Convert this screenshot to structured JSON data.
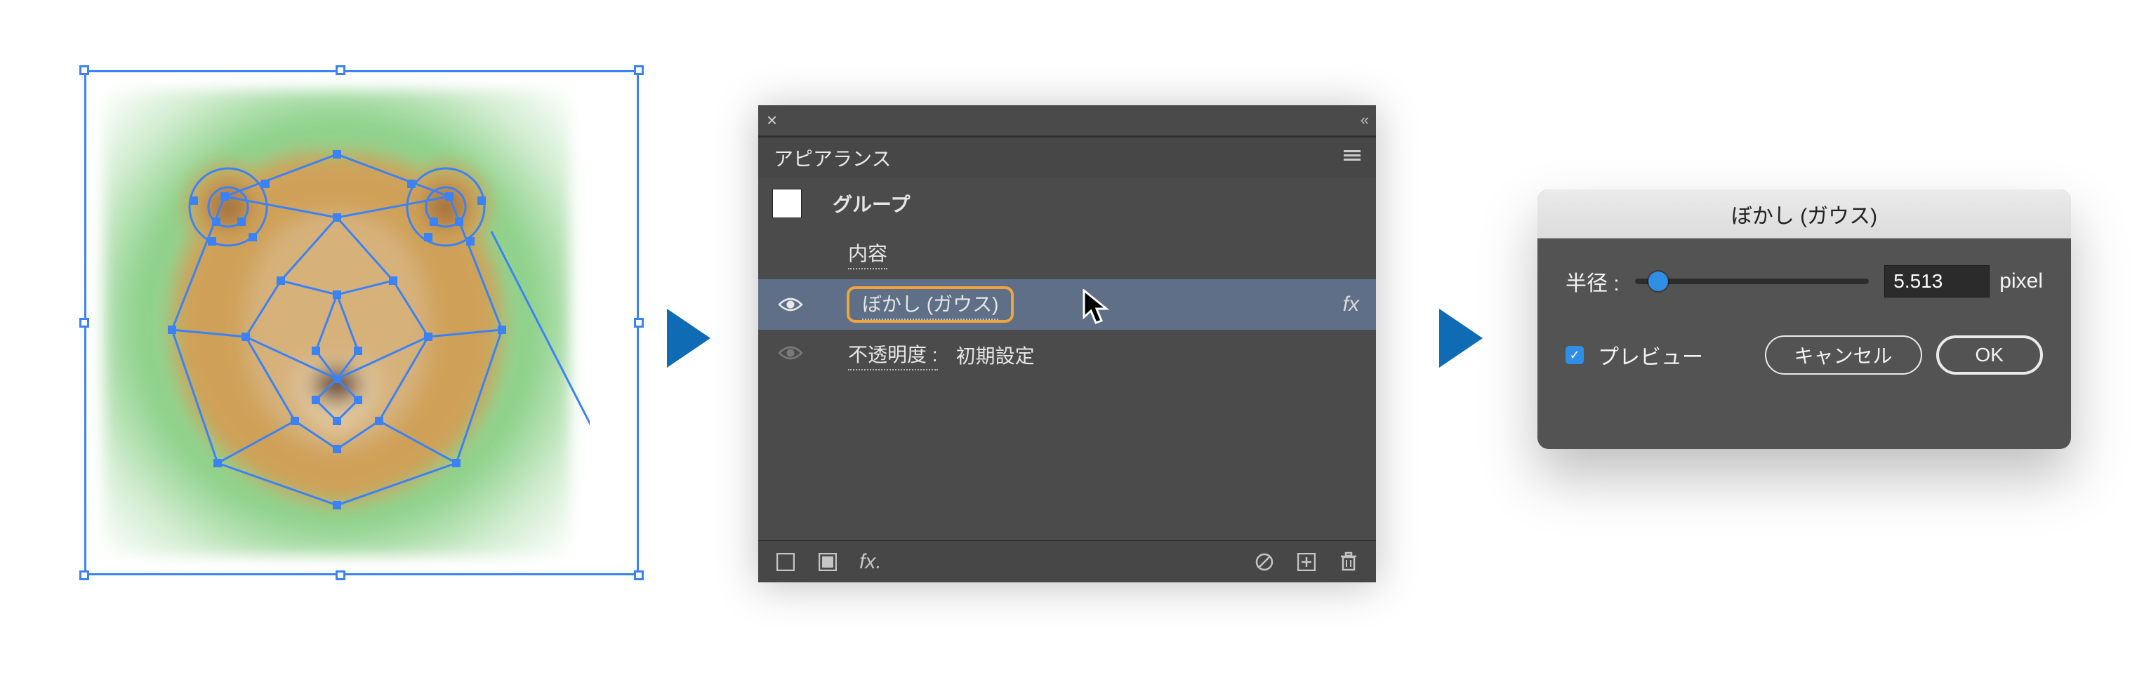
{
  "canvas": {
    "selection_color": "#3b82f6",
    "bg_green": "#8fd28c",
    "lion_palette": {
      "main": "#cfa158",
      "face": "#d6b17a",
      "muzzle_light": "#e0c79e",
      "nose": "#6a4a3c",
      "ear_inner": "#a77640"
    },
    "anchor_count": 58
  },
  "arrows": {
    "color": "#0f6bb3"
  },
  "panel": {
    "close_glyph": "×",
    "collapse_glyph": "«",
    "title": "アピアランス",
    "swatch_fill": "#ffffff",
    "group_label": "グループ",
    "contents_label": "内容",
    "blur_label": "ぼかし (ガウス)",
    "fx_glyph": "fx",
    "opacity_label": "不透明度 :",
    "opacity_value": "初期設定",
    "footer": {
      "icon_names": [
        "no-fill-icon",
        "swatch-icon",
        "fx-menu-icon",
        "prohibit-icon",
        "add-icon",
        "trash-icon"
      ],
      "fx_label": "fx."
    }
  },
  "dialog": {
    "title": "ぼかし (ガウス)",
    "radius_label": "半径 :",
    "radius_value": "5.513",
    "radius_unit": "pixel",
    "slider_position_pct": 10,
    "preview_checked": true,
    "preview_label": "プレビュー",
    "cancel_label": "キャンセル",
    "ok_label": "OK"
  }
}
